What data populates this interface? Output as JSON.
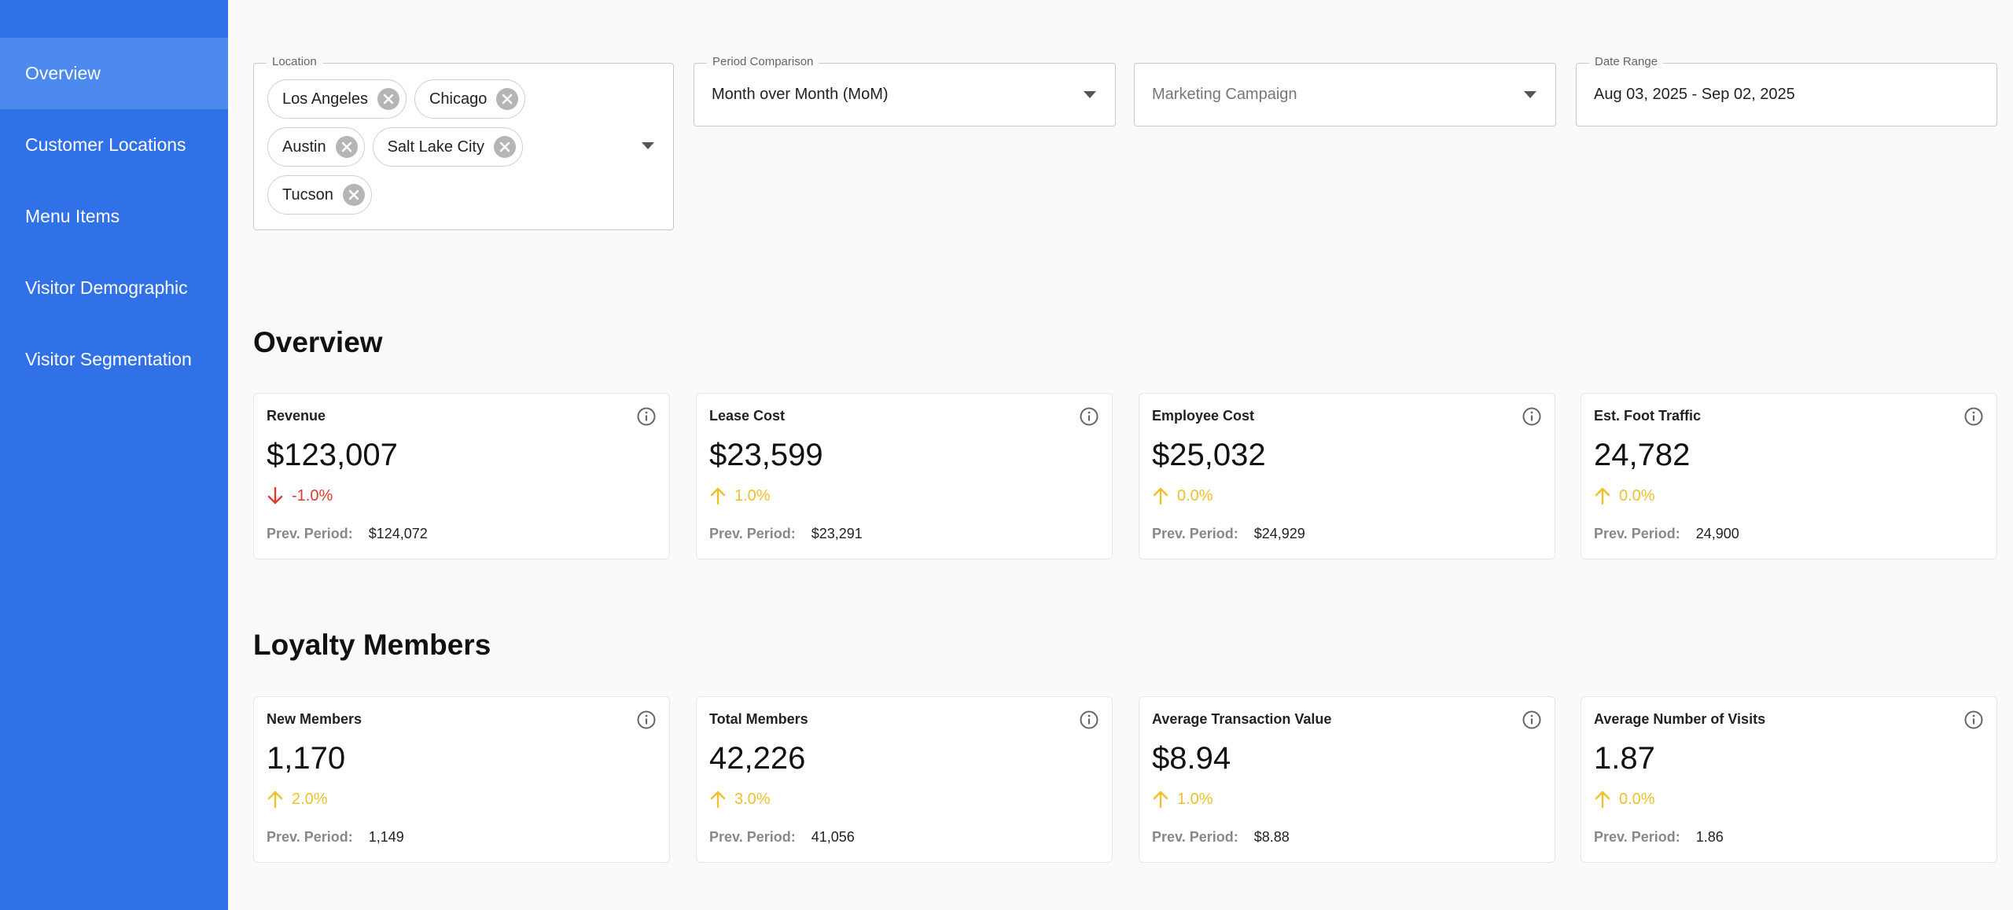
{
  "sidebar": {
    "items": [
      {
        "label": "Overview",
        "active": true
      },
      {
        "label": "Customer Locations",
        "active": false
      },
      {
        "label": "Menu Items",
        "active": false
      },
      {
        "label": "Visitor Demographic",
        "active": false
      },
      {
        "label": "Visitor Segmentation",
        "active": false
      }
    ]
  },
  "filters": {
    "location": {
      "label": "Location",
      "chips": [
        "Los Angeles",
        "Chicago",
        "Austin",
        "Salt Lake City",
        "Tucson"
      ]
    },
    "period": {
      "label": "Period Comparison",
      "value": "Month over Month (MoM)"
    },
    "campaign": {
      "placeholder": "Marketing Campaign"
    },
    "date_range": {
      "label": "Date Range",
      "value": "Aug 03, 2025 - Sep 02, 2025"
    }
  },
  "overview": {
    "title": "Overview",
    "cards": [
      {
        "title": "Revenue",
        "value": "$123,007",
        "delta": "-1.0%",
        "direction": "down",
        "prev_label": "Prev. Period:",
        "prev_value": "$124,072"
      },
      {
        "title": "Lease Cost",
        "value": "$23,599",
        "delta": "1.0%",
        "direction": "up",
        "prev_label": "Prev. Period:",
        "prev_value": "$23,291"
      },
      {
        "title": "Employee Cost",
        "value": "$25,032",
        "delta": "0.0%",
        "direction": "up",
        "prev_label": "Prev. Period:",
        "prev_value": "$24,929"
      },
      {
        "title": "Est. Foot Traffic",
        "value": "24,782",
        "delta": "0.0%",
        "direction": "up",
        "prev_label": "Prev. Period:",
        "prev_value": "24,900"
      }
    ]
  },
  "loyalty": {
    "title": "Loyalty Members",
    "cards": [
      {
        "title": "New Members",
        "value": "1,170",
        "delta": "2.0%",
        "direction": "up",
        "prev_label": "Prev. Period:",
        "prev_value": "1,149"
      },
      {
        "title": "Total Members",
        "value": "42,226",
        "delta": "3.0%",
        "direction": "up",
        "prev_label": "Prev. Period:",
        "prev_value": "41,056"
      },
      {
        "title": "Average Transaction Value",
        "value": "$8.94",
        "delta": "1.0%",
        "direction": "up",
        "prev_label": "Prev. Period:",
        "prev_value": "$8.88"
      },
      {
        "title": "Average Number of Visits",
        "value": "1.87",
        "delta": "0.0%",
        "direction": "up",
        "prev_label": "Prev. Period:",
        "prev_value": "1.86"
      }
    ]
  },
  "colors": {
    "sidebar": "#3171e8",
    "sidebar_active": "#4d8af0",
    "delta_down": "#e03a2c",
    "delta_up": "#f0c02a"
  },
  "icons": {
    "info": "info-circle-icon",
    "remove_chip": "close-circle-icon",
    "dropdown": "caret-down-icon",
    "trend_up": "arrow-up-icon",
    "trend_down": "arrow-down-icon"
  }
}
